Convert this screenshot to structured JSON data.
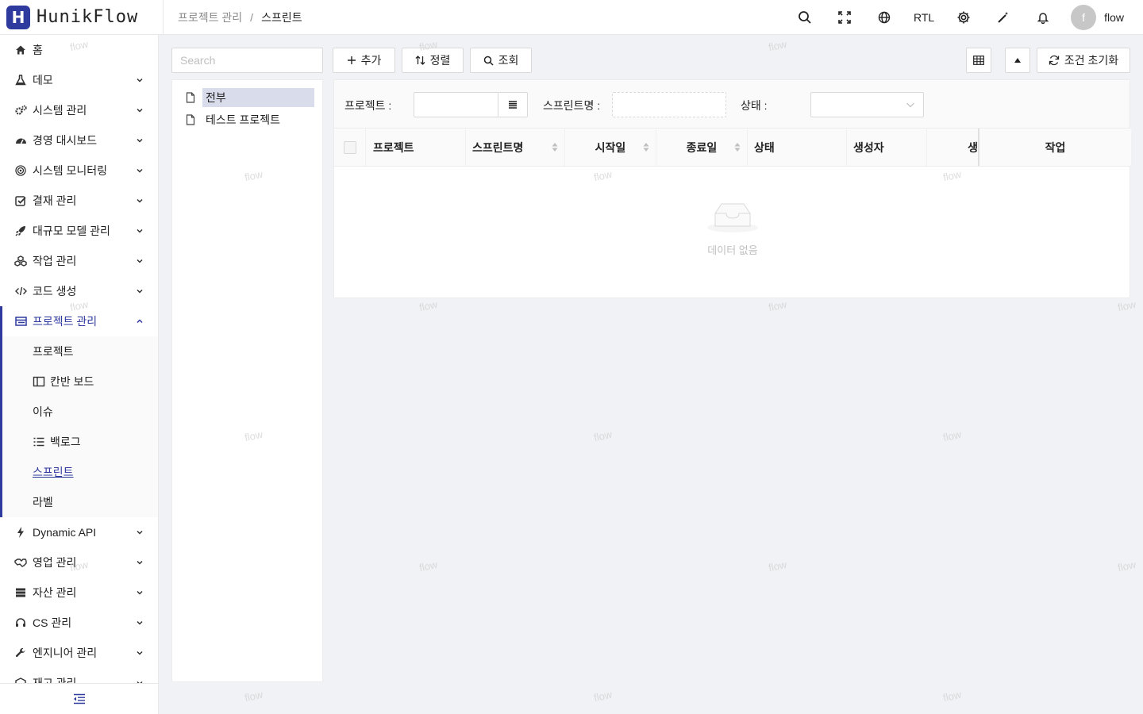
{
  "app": {
    "logo_letter": "H",
    "logo_text": "HunikFlow",
    "brand_color": "#2f3a9e"
  },
  "breadcrumb": {
    "parent": "프로젝트 관리",
    "separator": "/",
    "current": "스프린트"
  },
  "header": {
    "rtl_label": "RTL",
    "user_initial": "f",
    "username": "flow"
  },
  "sidebar": {
    "items": [
      {
        "label": "홈",
        "icon": "home-icon"
      },
      {
        "label": "데모",
        "icon": "flask-icon"
      },
      {
        "label": "시스템 관리",
        "icon": "gears-icon"
      },
      {
        "label": "경영 대시보드",
        "icon": "gauge-icon"
      },
      {
        "label": "시스템 모니터링",
        "icon": "target-icon"
      },
      {
        "label": "결재 관리",
        "icon": "check-square-icon"
      },
      {
        "label": "대규모 모델 관리",
        "icon": "rocket-icon"
      },
      {
        "label": "작업 관리",
        "icon": "cubes-icon"
      },
      {
        "label": "코드 생성",
        "icon": "code-icon"
      },
      {
        "label": "프로젝트 관리",
        "icon": "project-icon"
      },
      {
        "label": "Dynamic API",
        "icon": "bolt-icon"
      },
      {
        "label": "영업 관리",
        "icon": "handshake-icon"
      },
      {
        "label": "자산 관리",
        "icon": "server-icon"
      },
      {
        "label": "CS 관리",
        "icon": "headset-icon"
      },
      {
        "label": "엔지니어 관리",
        "icon": "wrench-icon"
      },
      {
        "label": "재고 관리",
        "icon": "box-icon"
      }
    ],
    "project_sub": [
      {
        "label": "프로젝트"
      },
      {
        "label": "칸반 보드",
        "icon": "columns-icon"
      },
      {
        "label": "이슈"
      },
      {
        "label": "백로그",
        "icon": "list-icon"
      },
      {
        "label": "스프린트",
        "active": true
      },
      {
        "label": "라벨"
      }
    ]
  },
  "toolbar": {
    "search_placeholder": "Search",
    "add_label": "추가",
    "sort_label": "정렬",
    "query_label": "조회",
    "reset_label": "조건 초기화"
  },
  "tree": {
    "items": [
      "전부",
      "테스트 프로젝트"
    ],
    "selected": "전부"
  },
  "filters": {
    "project_label": "프로젝트 :",
    "project_value": "",
    "sprint_name_label": "스프린트명 :",
    "sprint_name_value": "",
    "status_label": "상태 :",
    "status_value": ""
  },
  "table": {
    "columns": [
      "프로젝트",
      "스프린트명",
      "시작일",
      "종료일",
      "상태",
      "생성자",
      "생",
      "작업"
    ],
    "rows": [],
    "empty_text": "데이터 없음"
  },
  "watermark_text": "flow"
}
